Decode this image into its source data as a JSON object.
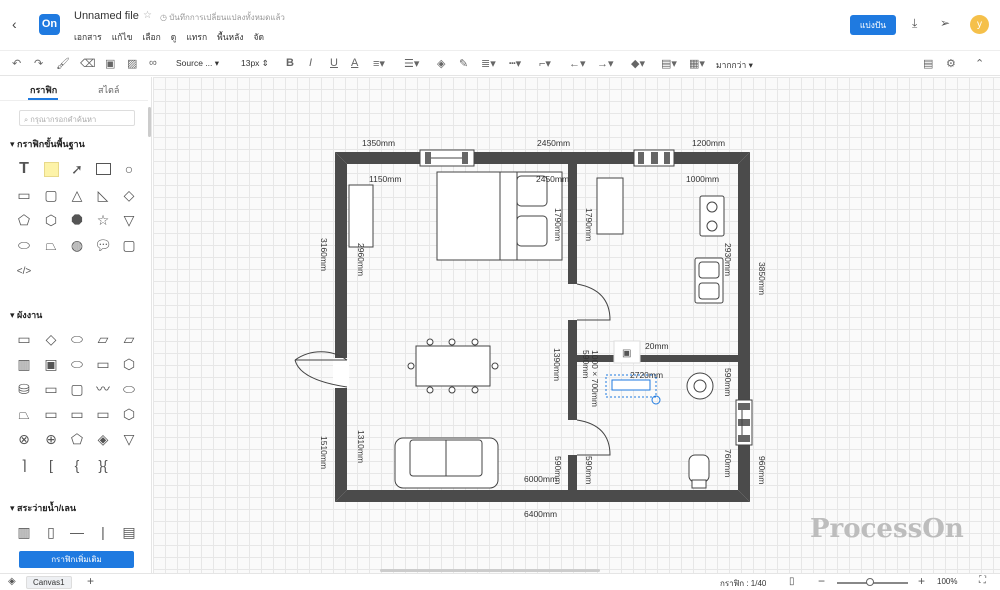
{
  "header": {
    "back_icon": "‹",
    "logo": "On",
    "file_name": "Unnamed file",
    "saved_status": "บันทึกการเปลี่ยนแปลงทั้งหมดแล้ว",
    "menu": [
      "เอกสาร",
      "แก้ไข",
      "เลือก",
      "ดู",
      "แทรก",
      "พื้นหลัง",
      "จัด"
    ],
    "share_label": "แบ่งปัน",
    "avatar_letter": "y"
  },
  "toolbar": {
    "font": "Source ...",
    "font_size": "13px",
    "more": "มากกว่า"
  },
  "sidebar": {
    "tabs": [
      "กราฟิก",
      "สไตล์"
    ],
    "search_placeholder": "กรุณากรอกคำค้นหา",
    "sections": [
      "กราฟิกขั้นพื้นฐาน",
      "ผังงาน",
      "สระว่ายน้ำ/เลน"
    ],
    "more_button": "กราฟิกเพิ่มเติม"
  },
  "canvas": {
    "dimensions": {
      "d1350": "1350mm",
      "d2450": "2450mm",
      "d1200": "1200mm",
      "d1150": "1150mm",
      "d2450b": "2450mm",
      "d1000": "1000mm",
      "d1790a": "1790mm",
      "d1790b": "1790mm",
      "d3160": "3160mm",
      "d2960": "2960mm",
      "d2930": "2930mm",
      "d3850": "3850mm",
      "d20": "20mm",
      "d1390": "1390mm",
      "d590a": "590mm",
      "d2720": "2720mm",
      "d1000x700": "1000 × 700mm",
      "d590b": "590mm",
      "d1510": "1510mm",
      "d1310": "1310mm",
      "d590c": "590mm",
      "d590d": "590mm",
      "d760": "760mm",
      "d960": "960mm",
      "d6000": "6000mm",
      "d6400": "6400mm"
    },
    "watermark": "ProcessOn"
  },
  "bottom": {
    "canvas_tab": "Canvas1",
    "page_info": "กราฟิก : 1/40",
    "zoom": "100%"
  }
}
